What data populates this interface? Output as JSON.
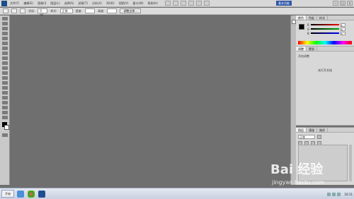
{
  "menubar": {
    "items": [
      "文件(F)",
      "编辑(E)",
      "图像(I)",
      "图层(L)",
      "选择(S)",
      "滤镜(T)",
      "分析(A)",
      "3D(D)",
      "视图(V)",
      "窗口(W)",
      "帮助(H)"
    ],
    "workspace_label": "基本功能",
    "win_min": "−",
    "win_max": "□",
    "win_close": "×"
  },
  "optbar": {
    "feather_label": "羽化:",
    "feather_value": "0 px",
    "style_label": "样式:",
    "style_value": "正常",
    "width_label": "宽度:",
    "height_label": "高度:",
    "refine_edge": "调整边缘..."
  },
  "color_panel": {
    "tabs": [
      "颜色",
      "色板",
      "样式"
    ],
    "channels": [
      {
        "label": "R",
        "value": "0",
        "color": "#ff0000"
      },
      {
        "label": "G",
        "value": "0",
        "color": "#00aa00"
      },
      {
        "label": "B",
        "value": "0",
        "color": "#0000ff"
      }
    ]
  },
  "adjust_panel": {
    "tabs": [
      "调整",
      "蒙版"
    ],
    "subtitle": "添加调整",
    "message": "未打开文档"
  },
  "layers_panel": {
    "tabs": [
      "图层",
      "通道",
      "路径"
    ],
    "blend_mode": "正常"
  },
  "taskbar": {
    "start_label": "开始",
    "clock": "10:11"
  },
  "watermark": {
    "logo": "Bai 经验",
    "url": "jingyan.baidu.com"
  }
}
